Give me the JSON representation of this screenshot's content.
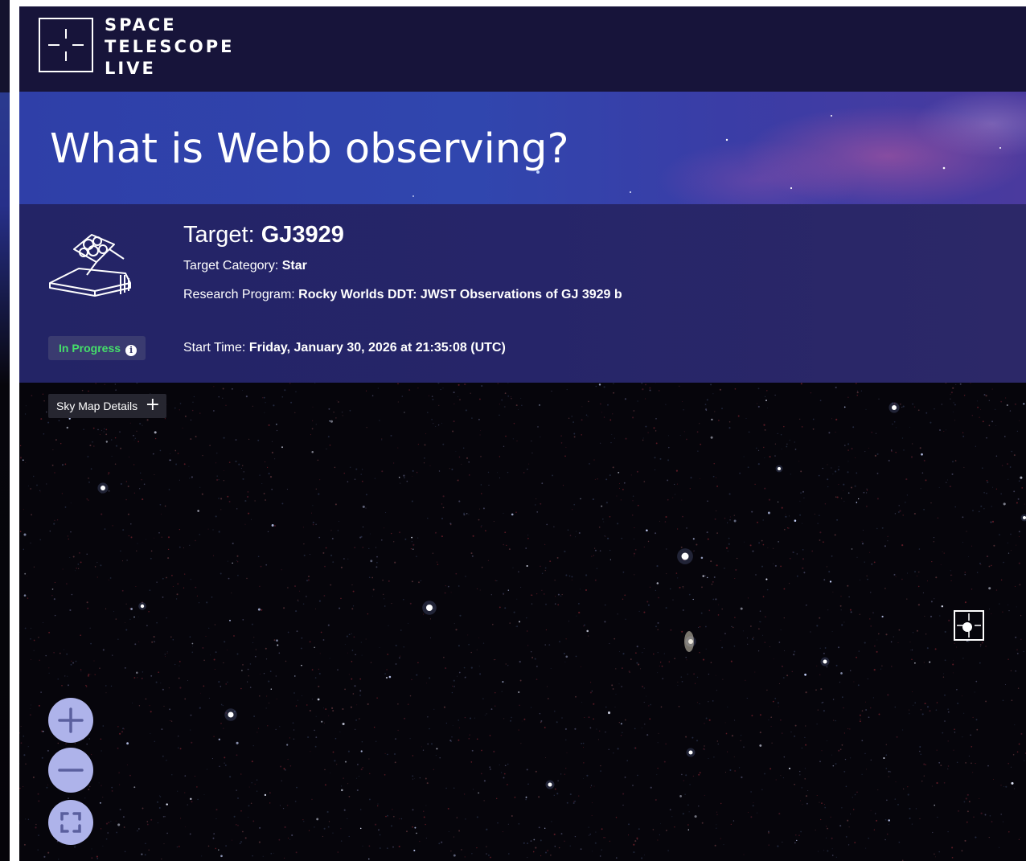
{
  "header": {
    "logo_lines": [
      "SPACE",
      "TELESCOPE",
      "LIVE"
    ]
  },
  "hero": {
    "title": "What is Webb observing?"
  },
  "target": {
    "label": "Target:",
    "name": "GJ3929",
    "category_label": "Target Category:",
    "category": "Star",
    "program_label": "Research Program:",
    "program": "Rocky Worlds DDT: JWST Observations of GJ 3929 b",
    "start_label": "Start Time:",
    "start_time": "Friday, January 30, 2026 at 21:35:08 (UTC)"
  },
  "status": {
    "label": "In Progress",
    "icon": "info-icon",
    "color": "#45e06a"
  },
  "sky_map": {
    "details_label": "Sky Map Details",
    "details_icon": "plus-icon",
    "controls": [
      "zoom-in-icon",
      "zoom-out-icon",
      "fullscreen-icon"
    ]
  },
  "colors": {
    "header_bg": "#17143a",
    "hero_bg": "#3046ae",
    "panel_bg": "#252568",
    "control_bg": "#aeb3ea"
  }
}
